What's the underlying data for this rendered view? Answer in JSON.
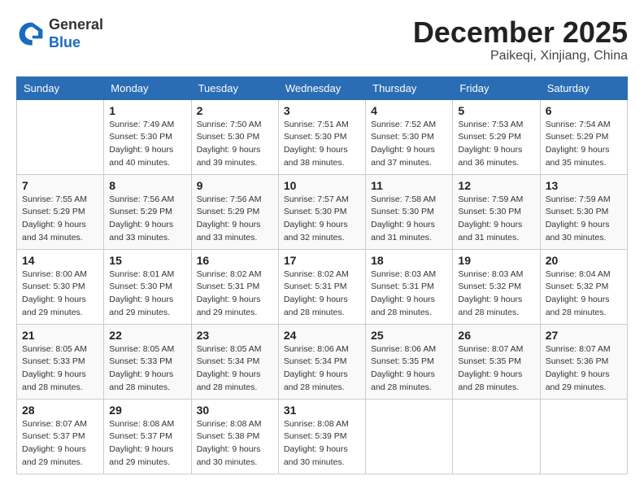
{
  "logo": {
    "general": "General",
    "blue": "Blue"
  },
  "header": {
    "month": "December 2025",
    "location": "Paikeqi, Xinjiang, China"
  },
  "weekdays": [
    "Sunday",
    "Monday",
    "Tuesday",
    "Wednesday",
    "Thursday",
    "Friday",
    "Saturday"
  ],
  "weeks": [
    [
      {
        "day": "",
        "info": ""
      },
      {
        "day": "1",
        "info": "Sunrise: 7:49 AM\nSunset: 5:30 PM\nDaylight: 9 hours\nand 40 minutes."
      },
      {
        "day": "2",
        "info": "Sunrise: 7:50 AM\nSunset: 5:30 PM\nDaylight: 9 hours\nand 39 minutes."
      },
      {
        "day": "3",
        "info": "Sunrise: 7:51 AM\nSunset: 5:30 PM\nDaylight: 9 hours\nand 38 minutes."
      },
      {
        "day": "4",
        "info": "Sunrise: 7:52 AM\nSunset: 5:30 PM\nDaylight: 9 hours\nand 37 minutes."
      },
      {
        "day": "5",
        "info": "Sunrise: 7:53 AM\nSunset: 5:29 PM\nDaylight: 9 hours\nand 36 minutes."
      },
      {
        "day": "6",
        "info": "Sunrise: 7:54 AM\nSunset: 5:29 PM\nDaylight: 9 hours\nand 35 minutes."
      }
    ],
    [
      {
        "day": "7",
        "info": "Sunrise: 7:55 AM\nSunset: 5:29 PM\nDaylight: 9 hours\nand 34 minutes."
      },
      {
        "day": "8",
        "info": "Sunrise: 7:56 AM\nSunset: 5:29 PM\nDaylight: 9 hours\nand 33 minutes."
      },
      {
        "day": "9",
        "info": "Sunrise: 7:56 AM\nSunset: 5:29 PM\nDaylight: 9 hours\nand 33 minutes."
      },
      {
        "day": "10",
        "info": "Sunrise: 7:57 AM\nSunset: 5:30 PM\nDaylight: 9 hours\nand 32 minutes."
      },
      {
        "day": "11",
        "info": "Sunrise: 7:58 AM\nSunset: 5:30 PM\nDaylight: 9 hours\nand 31 minutes."
      },
      {
        "day": "12",
        "info": "Sunrise: 7:59 AM\nSunset: 5:30 PM\nDaylight: 9 hours\nand 31 minutes."
      },
      {
        "day": "13",
        "info": "Sunrise: 7:59 AM\nSunset: 5:30 PM\nDaylight: 9 hours\nand 30 minutes."
      }
    ],
    [
      {
        "day": "14",
        "info": "Sunrise: 8:00 AM\nSunset: 5:30 PM\nDaylight: 9 hours\nand 29 minutes."
      },
      {
        "day": "15",
        "info": "Sunrise: 8:01 AM\nSunset: 5:30 PM\nDaylight: 9 hours\nand 29 minutes."
      },
      {
        "day": "16",
        "info": "Sunrise: 8:02 AM\nSunset: 5:31 PM\nDaylight: 9 hours\nand 29 minutes."
      },
      {
        "day": "17",
        "info": "Sunrise: 8:02 AM\nSunset: 5:31 PM\nDaylight: 9 hours\nand 28 minutes."
      },
      {
        "day": "18",
        "info": "Sunrise: 8:03 AM\nSunset: 5:31 PM\nDaylight: 9 hours\nand 28 minutes."
      },
      {
        "day": "19",
        "info": "Sunrise: 8:03 AM\nSunset: 5:32 PM\nDaylight: 9 hours\nand 28 minutes."
      },
      {
        "day": "20",
        "info": "Sunrise: 8:04 AM\nSunset: 5:32 PM\nDaylight: 9 hours\nand 28 minutes."
      }
    ],
    [
      {
        "day": "21",
        "info": "Sunrise: 8:05 AM\nSunset: 5:33 PM\nDaylight: 9 hours\nand 28 minutes."
      },
      {
        "day": "22",
        "info": "Sunrise: 8:05 AM\nSunset: 5:33 PM\nDaylight: 9 hours\nand 28 minutes."
      },
      {
        "day": "23",
        "info": "Sunrise: 8:05 AM\nSunset: 5:34 PM\nDaylight: 9 hours\nand 28 minutes."
      },
      {
        "day": "24",
        "info": "Sunrise: 8:06 AM\nSunset: 5:34 PM\nDaylight: 9 hours\nand 28 minutes."
      },
      {
        "day": "25",
        "info": "Sunrise: 8:06 AM\nSunset: 5:35 PM\nDaylight: 9 hours\nand 28 minutes."
      },
      {
        "day": "26",
        "info": "Sunrise: 8:07 AM\nSunset: 5:35 PM\nDaylight: 9 hours\nand 28 minutes."
      },
      {
        "day": "27",
        "info": "Sunrise: 8:07 AM\nSunset: 5:36 PM\nDaylight: 9 hours\nand 29 minutes."
      }
    ],
    [
      {
        "day": "28",
        "info": "Sunrise: 8:07 AM\nSunset: 5:37 PM\nDaylight: 9 hours\nand 29 minutes."
      },
      {
        "day": "29",
        "info": "Sunrise: 8:08 AM\nSunset: 5:37 PM\nDaylight: 9 hours\nand 29 minutes."
      },
      {
        "day": "30",
        "info": "Sunrise: 8:08 AM\nSunset: 5:38 PM\nDaylight: 9 hours\nand 30 minutes."
      },
      {
        "day": "31",
        "info": "Sunrise: 8:08 AM\nSunset: 5:39 PM\nDaylight: 9 hours\nand 30 minutes."
      },
      {
        "day": "",
        "info": ""
      },
      {
        "day": "",
        "info": ""
      },
      {
        "day": "",
        "info": ""
      }
    ]
  ]
}
